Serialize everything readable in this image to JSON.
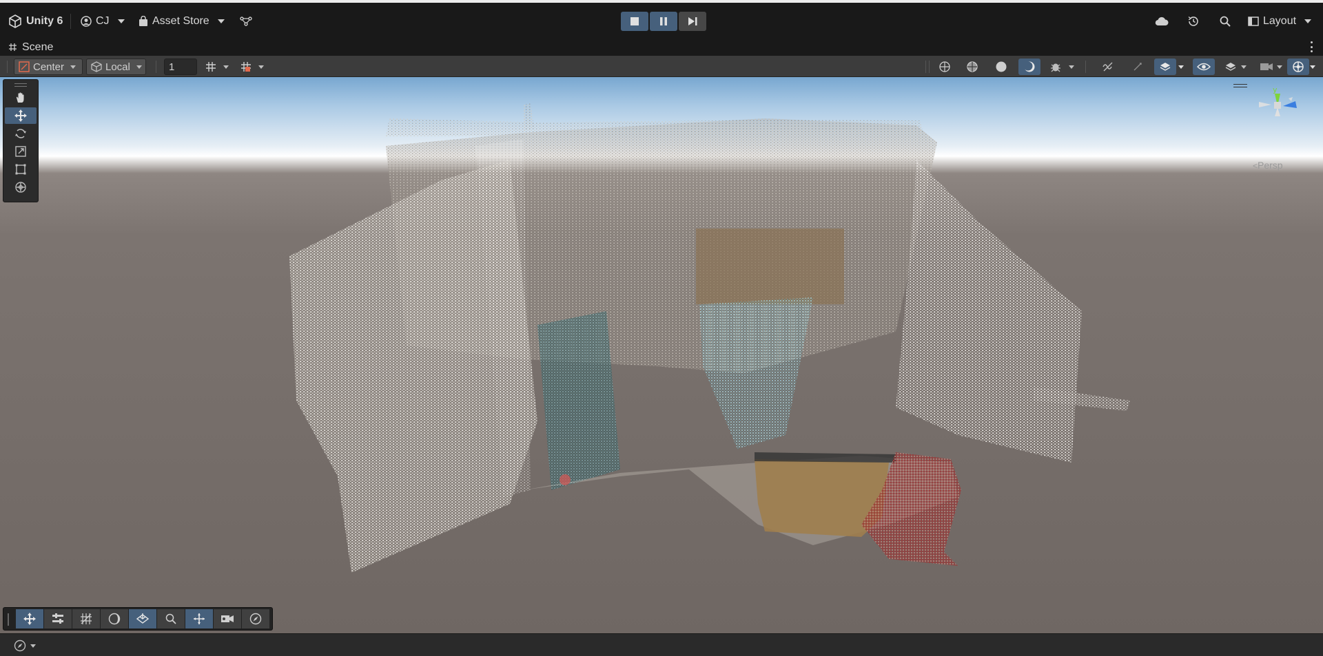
{
  "titlebar": {
    "app_name": "Unity 6",
    "account": "CJ",
    "asset_store": "Asset Store",
    "layout": "Layout",
    "playmode": {
      "stop_active": true,
      "pause_active": true,
      "step_active": false
    }
  },
  "scene_tab": {
    "title": "Scene"
  },
  "scene_toolbar": {
    "pivot_mode": "Center",
    "pivot_rotation": "Local",
    "grid_value": "1",
    "draw_mode_icons": [
      "wireframe-globe-icon",
      "shaded-wire-globe-icon",
      "shaded-sphere-icon",
      "lighting-icon",
      "gizmo-bug-icon"
    ],
    "right_icons": [
      "audio-mute-icon",
      "effects-icon",
      "layers-icon",
      "visibility-eye-icon",
      "scene-layers-icon",
      "camera-icon",
      "gizmos-globe-icon"
    ]
  },
  "tools_palette": {
    "tools": [
      "hand-tool-icon",
      "move-tool-icon",
      "rotate-tool-icon",
      "scale-tool-icon",
      "rect-tool-icon",
      "transform-tool-icon"
    ],
    "active_tool": "move-tool-icon"
  },
  "view_gizmo": {
    "y_label": "y",
    "projection": "Persp",
    "axis_colors": {
      "y": "#7ed43a",
      "x": "#d8d8d8",
      "z": "#3a7ee0"
    }
  },
  "overlay_toolbar": {
    "buttons": [
      "move-overlay-icon",
      "settings-sliders-icon",
      "grid-hatch-icon",
      "lighting-moon-icon",
      "snap-plane-icon",
      "search-zoom-icon",
      "pivot-cross-icon",
      "camera-preview-icon",
      "navigation-compass-icon"
    ],
    "active": [
      0,
      4,
      6
    ]
  },
  "colors": {
    "accent": "#46607c",
    "panel": "#3c3c3c",
    "ground": "#756d69",
    "horizon": "#ffffff"
  }
}
